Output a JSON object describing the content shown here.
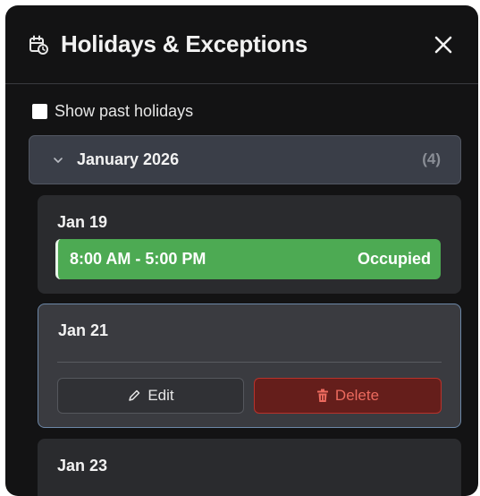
{
  "dialog": {
    "title": "Holidays & Exceptions",
    "icon": "calendar-clock-icon",
    "close_icon": "close-icon"
  },
  "filter": {
    "show_past_label": "Show past holidays",
    "show_past_checked": false
  },
  "month_group": {
    "label": "January 2026",
    "count": "(4)",
    "expanded": true
  },
  "days": [
    {
      "date": "Jan 19",
      "slot": {
        "time": "8:00 AM - 5:00 PM",
        "status": "Occupied"
      }
    },
    {
      "date": "Jan 21",
      "selected": true,
      "actions": {
        "edit_label": "Edit",
        "delete_label": "Delete"
      }
    },
    {
      "date": "Jan 23"
    }
  ],
  "colors": {
    "panel_bg": "#131314",
    "occupied": "#4daa53",
    "danger": "#ec6a5e",
    "selected_border": "#6c87a7"
  }
}
